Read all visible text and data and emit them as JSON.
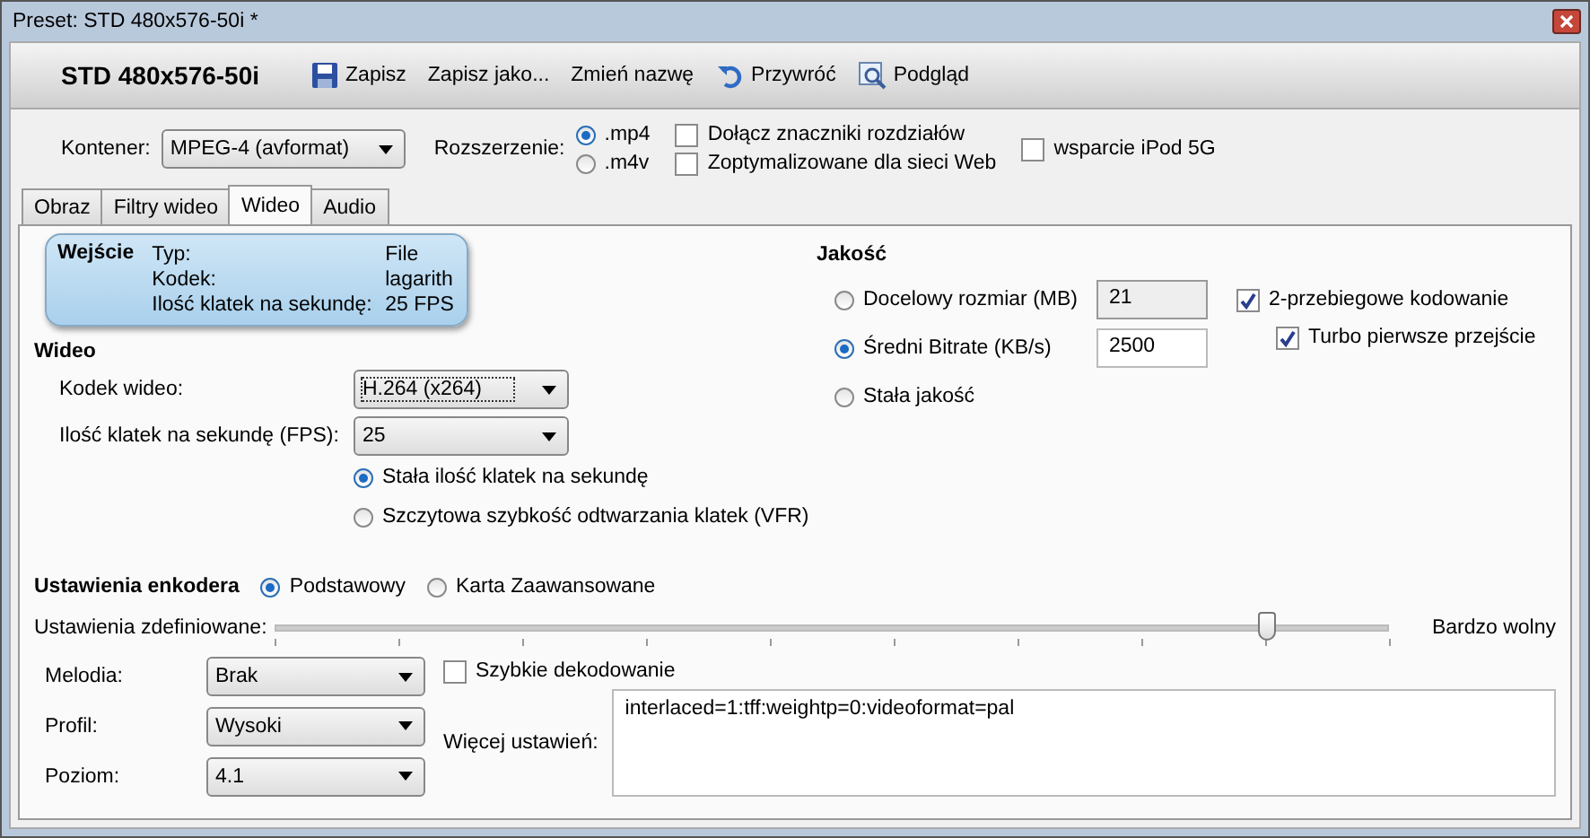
{
  "window": {
    "title": "Preset: STD 480x576-50i *"
  },
  "toolbar": {
    "preset_name": "STD 480x576-50i",
    "buttons": [
      {
        "label": "Zapisz"
      },
      {
        "label": "Zapisz jako..."
      },
      {
        "label": "Zmień nazwę"
      },
      {
        "label": "Przywróć"
      },
      {
        "label": "Podgląd"
      }
    ]
  },
  "container": {
    "label": "Kontener:",
    "value": "MPEG-4 (avformat)"
  },
  "extension": {
    "label": "Rozszerzenie:",
    "options": [
      {
        "label": ".mp4",
        "selected": true
      },
      {
        "label": ".m4v",
        "selected": false
      }
    ]
  },
  "options": [
    {
      "label": "Dołącz znaczniki rozdziałów",
      "checked": false
    },
    {
      "label": "Zoptymalizowane dla sieci Web",
      "checked": false
    },
    {
      "label": "wsparcie iPod 5G",
      "checked": false
    }
  ],
  "tabs": [
    {
      "label": "Obraz",
      "selected": false
    },
    {
      "label": "Filtry wideo",
      "selected": false
    },
    {
      "label": "Wideo",
      "selected": true
    },
    {
      "label": "Audio",
      "selected": false
    }
  ],
  "input_info": {
    "title": "Wejście",
    "rows": [
      {
        "label": "Typ:",
        "value": "File"
      },
      {
        "label": "Kodek:",
        "value": "lagarith"
      },
      {
        "label": "Ilość klatek na sekundę:",
        "value": "25 FPS"
      }
    ]
  },
  "video": {
    "heading": "Wideo",
    "codec": {
      "label": "Kodek wideo:",
      "value": "H.264 (x264)"
    },
    "fps": {
      "label": "Ilość klatek na sekundę (FPS):",
      "value": "25"
    },
    "fps_modes": [
      {
        "label": "Stała ilość klatek na sekundę",
        "selected": true
      },
      {
        "label": "Szczytowa szybkość odtwarzania klatek (VFR)",
        "selected": false
      }
    ]
  },
  "quality": {
    "heading": "Jakość",
    "modes": [
      {
        "label": "Docelowy rozmiar (MB)",
        "selected": false,
        "value": "21",
        "disabled": true
      },
      {
        "label": "Średni Bitrate (KB/s)",
        "selected": true,
        "value": "2500",
        "disabled": false
      },
      {
        "label": "Stała jakość",
        "selected": false
      }
    ],
    "two_pass": {
      "label": "2-przebiegowe kodowanie",
      "checked": true
    },
    "turbo": {
      "label": "Turbo pierwsze przejście",
      "checked": true
    }
  },
  "encoder": {
    "heading": "Ustawienia enkodera",
    "modes": [
      {
        "label": "Podstawowy",
        "selected": true
      },
      {
        "label": "Karta Zaawansowane",
        "selected": false
      }
    ],
    "preset": {
      "label": "Ustawienia zdefiniowane:",
      "level": 0.89,
      "end_label": "Bardzo wolny"
    },
    "tune": {
      "label": "Melodia:",
      "value": "Brak"
    },
    "profile": {
      "label": "Profil:",
      "value": "Wysoki"
    },
    "level_select": {
      "label": "Poziom:",
      "value": "4.1"
    },
    "fast_decode": {
      "label": "Szybkie dekodowanie",
      "checked": false
    },
    "more": {
      "label": "Więcej ustawień:",
      "value": "interlaced=1:tff:weightp=0:videoformat=pal"
    }
  }
}
